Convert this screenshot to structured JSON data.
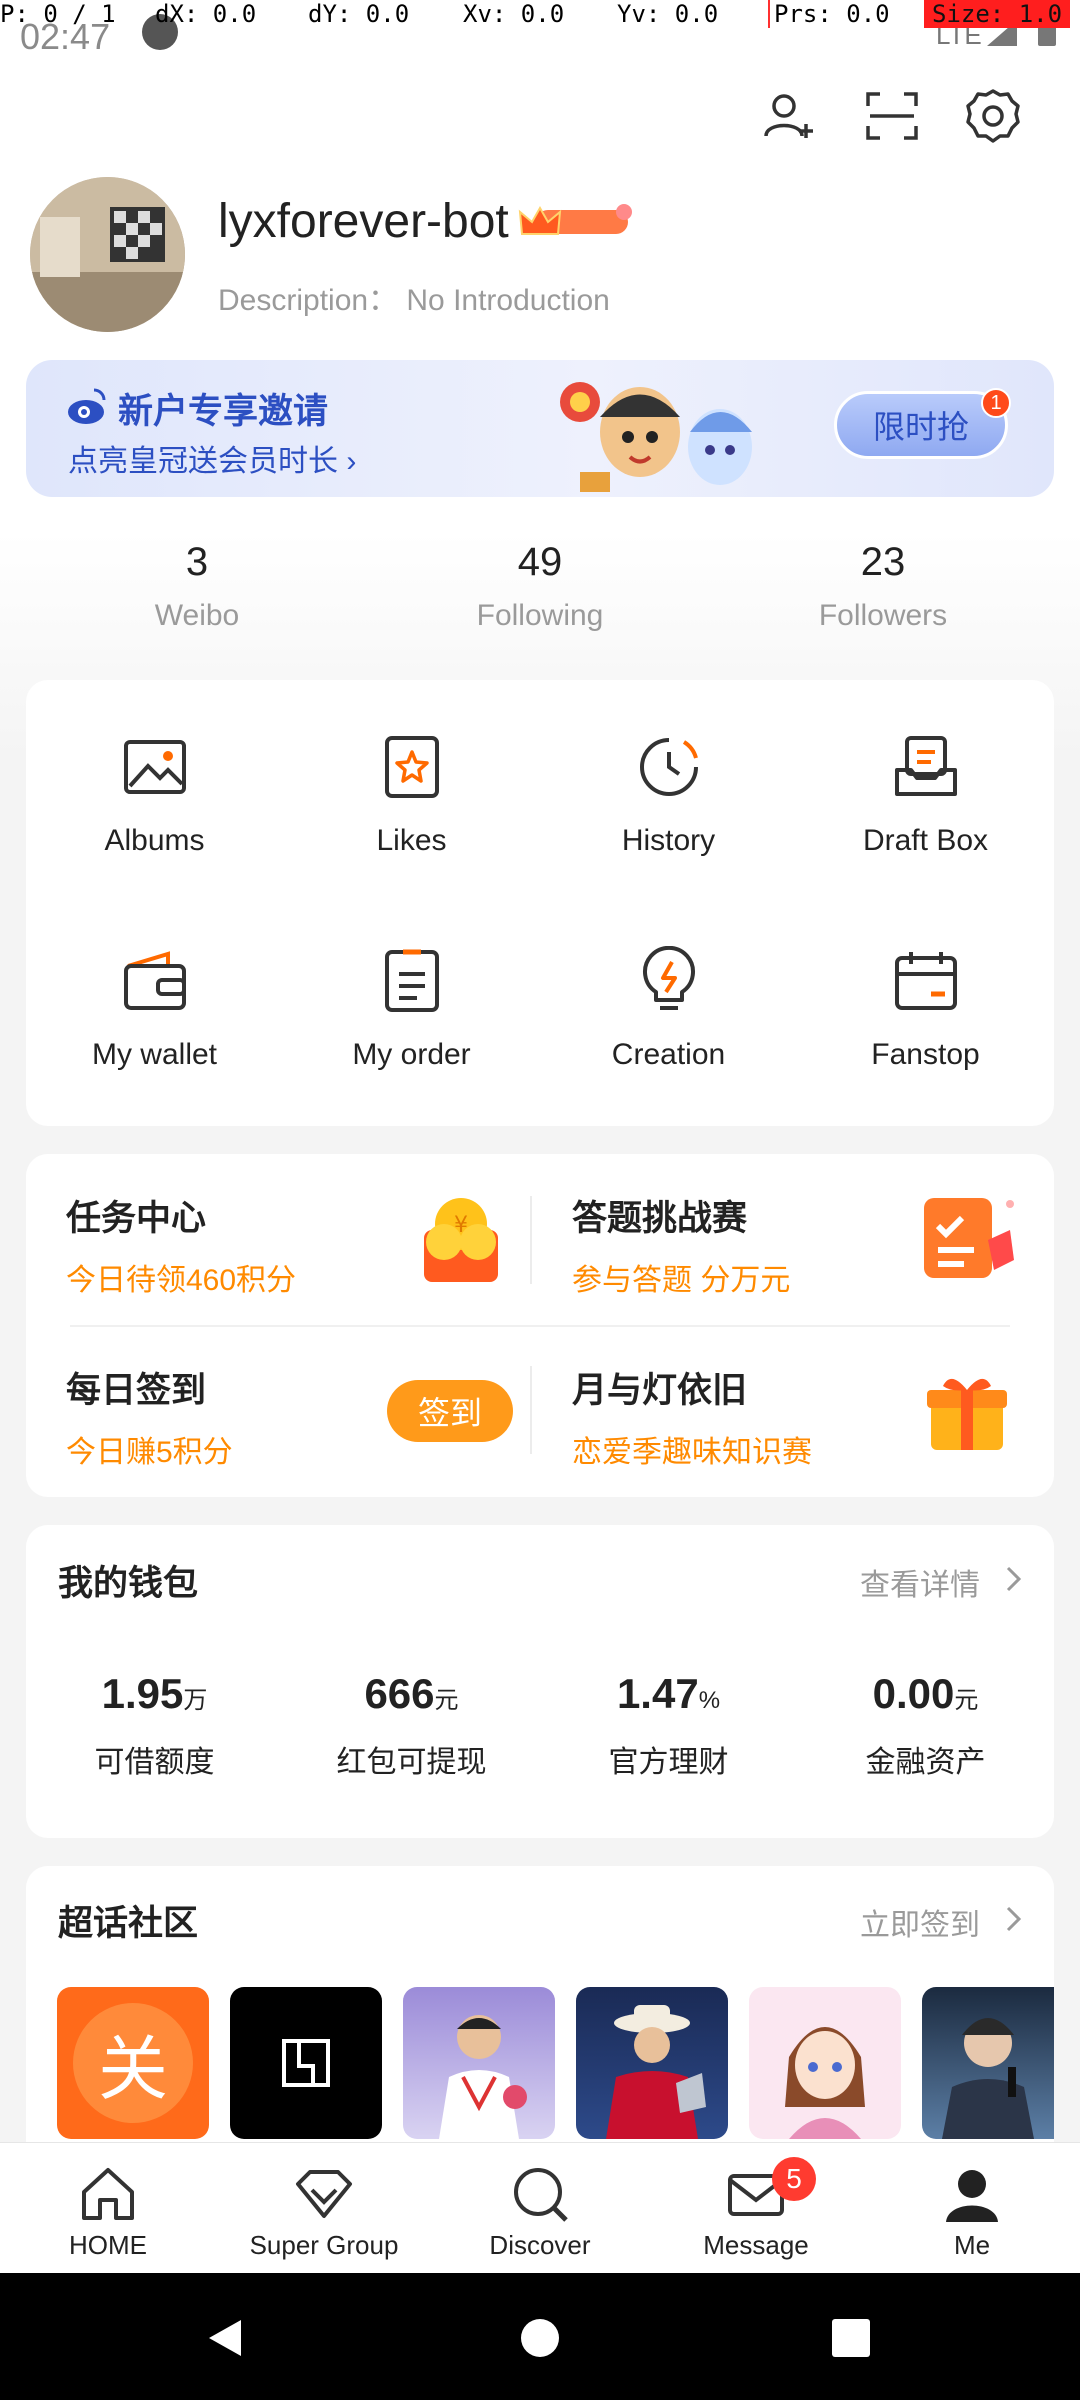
{
  "debug_bar": {
    "p": "P: 0 / 1",
    "dx": "dX: 0.0",
    "dy": "dY: 0.0",
    "xv": "Xv: 0.0",
    "yv": "Yv: 0.0",
    "prs": "Prs: 0.0",
    "size": "Size: 1.0"
  },
  "status_bar": {
    "time": "02:47",
    "network": "LTE"
  },
  "profile": {
    "username": "lyxforever-bot",
    "description": "Description： No Introduction"
  },
  "banner": {
    "title": "新户专享邀请",
    "subtitle": "点亮皇冠送会员时长 ›",
    "button": "限时抢",
    "badge": "1"
  },
  "stats": [
    {
      "value": "3",
      "label": "Weibo"
    },
    {
      "value": "49",
      "label": "Following"
    },
    {
      "value": "23",
      "label": "Followers"
    }
  ],
  "grid": [
    {
      "label": "Albums",
      "icon": "albums-icon"
    },
    {
      "label": "Likes",
      "icon": "likes-icon"
    },
    {
      "label": "History",
      "icon": "history-icon"
    },
    {
      "label": "Draft Box",
      "icon": "draft-box-icon"
    },
    {
      "label": "My wallet",
      "icon": "wallet-icon"
    },
    {
      "label": "My order",
      "icon": "order-icon"
    },
    {
      "label": "Creation",
      "icon": "creation-icon"
    },
    {
      "label": "Fanstop",
      "icon": "fanstop-icon"
    }
  ],
  "tasks": {
    "task_center": {
      "title": "任务中心",
      "subtitle": "今日待领460积分"
    },
    "quiz": {
      "title": "答题挑战赛",
      "subtitle": "参与答题 分万元"
    },
    "checkin": {
      "title": "每日签到",
      "subtitle": "今日赚5积分",
      "button": "签到"
    },
    "lantern": {
      "title": "月与灯依旧",
      "subtitle": "恋爱季趣味知识赛"
    }
  },
  "wallet": {
    "title": "我的钱包",
    "more": "查看详情",
    "items": [
      {
        "value": "1.95",
        "unit": "万",
        "label": "可借额度"
      },
      {
        "value": "666",
        "unit": "元",
        "label": "红包可提现"
      },
      {
        "value": "1.47",
        "unit": "%",
        "label": "官方理财"
      },
      {
        "value": "0.00",
        "unit": "元",
        "label": "金融资产"
      }
    ]
  },
  "community": {
    "title": "超话社区",
    "more": "立即签到",
    "first_thumb_text": "关"
  },
  "bottom_nav": [
    {
      "label": "HOME",
      "icon": "home-icon"
    },
    {
      "label": "Super Group",
      "icon": "super-group-icon"
    },
    {
      "label": "Discover",
      "icon": "discover-icon"
    },
    {
      "label": "Message",
      "icon": "message-icon",
      "badge": "5"
    },
    {
      "label": "Me",
      "icon": "me-icon"
    }
  ],
  "colors": {
    "accent_orange": "#ff8a00",
    "banner_blue": "#2c4fc2",
    "badge_red": "#ff3b30"
  }
}
